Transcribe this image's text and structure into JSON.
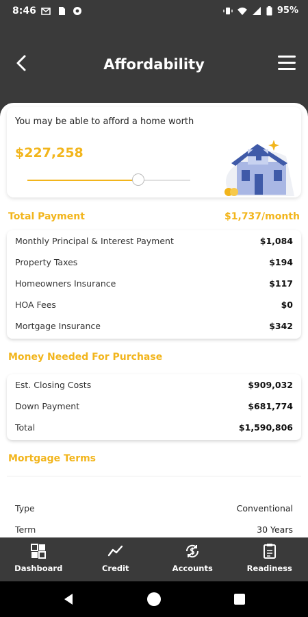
{
  "status_bar": {
    "time": "8:46",
    "battery": "95%"
  },
  "header": {
    "title": "Affordability"
  },
  "hero": {
    "label": "You may be able to afford a home worth",
    "price": "$227,258",
    "slider_level": 0.68
  },
  "total_payment": {
    "title": "Total Payment",
    "amount": "$1,737/month",
    "rows": [
      {
        "label": "Monthly Principal & Interest Payment",
        "value": "$1,084"
      },
      {
        "label": "Property Taxes",
        "value": "$194"
      },
      {
        "label": "Homeowners Insurance",
        "value": "$117"
      },
      {
        "label": "HOA Fees",
        "value": "$0"
      },
      {
        "label": "Mortgage Insurance",
        "value": "$342"
      }
    ]
  },
  "money_needed": {
    "title": "Money Needed For Purchase",
    "rows": [
      {
        "label": "Est. Closing Costs",
        "value": "$909,032"
      },
      {
        "label": "Down Payment",
        "value": "$681,774"
      },
      {
        "label": "Total",
        "value": "$1,590,806"
      }
    ]
  },
  "mortgage_terms": {
    "title": "Mortgage Terms",
    "rows": [
      {
        "label": "Type",
        "value": "Conventional"
      },
      {
        "label": "Term",
        "value": "30 Years"
      }
    ]
  },
  "bottom_nav": [
    {
      "label": "Dashboard",
      "icon": "dashboard-grid-icon"
    },
    {
      "label": "Credit",
      "icon": "chart-line-icon"
    },
    {
      "label": "Accounts",
      "icon": "dollar-sync-icon"
    },
    {
      "label": "Readiness",
      "icon": "clipboard-icon"
    }
  ],
  "colors": {
    "accent": "#f2b51c",
    "dark": "#3a3a3a",
    "house_blue": "#3f5aa8"
  }
}
